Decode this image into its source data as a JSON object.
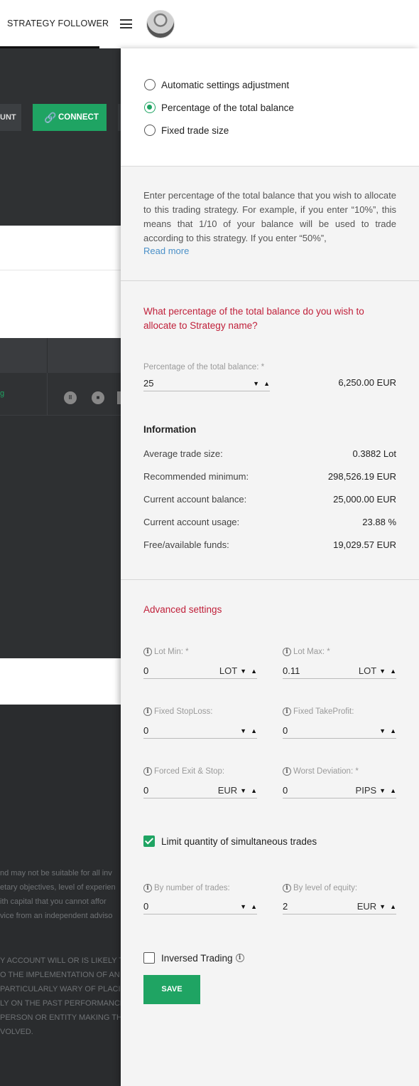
{
  "topbar": {
    "brand": "STRATEGY FOLLOWER"
  },
  "background": {
    "account_button": "UNT",
    "connect_button": "CONNECT",
    "row_status": "g",
    "disclaimer_1": [
      "nd may not be suitable for all inv",
      "etary objectives, level of experien",
      "ith capital that you cannot affor",
      "vice from an independent adviso"
    ],
    "disclaimer_2": [
      "Y ACCOUNT WILL OR IS LIKELY T",
      "O THE IMPLEMENTATION OF AN",
      "PARTICULARLY WARY OF PLACI",
      "LY ON THE PAST PERFORMANCE",
      "PERSON OR ENTITY MAKING TH",
      "VOLVED."
    ]
  },
  "panel": {
    "close_icon": "×",
    "modes": [
      {
        "label": "Automatic settings adjustment",
        "selected": false
      },
      {
        "label": "Percentage of the total balance",
        "selected": true
      },
      {
        "label": "Fixed trade size",
        "selected": false
      }
    ],
    "description": "Enter percentage of the total balance that you wish to allocate to this trading strategy. For example, if you enter “10%”, this means that 1/10 of your balance will be used to trade according to this strategy. If you enter “50%”,",
    "read_more": "Read more",
    "question": "What percentage of the total balance do you wish to allocate to Strategy name?",
    "percentage": {
      "label": "Percentage of the total balance: *",
      "value": "25",
      "calculated": "6,250.00 EUR"
    },
    "information": {
      "title": "Information",
      "rows": [
        {
          "label": "Average trade size:",
          "value": "0.3882 Lot"
        },
        {
          "label": "Recommended minimum:",
          "value": "298,526.19 EUR"
        },
        {
          "label": "Current account balance:",
          "value": "25,000.00 EUR"
        },
        {
          "label": "Current account usage:",
          "value": "23.88 %"
        },
        {
          "label": "Free/available funds:",
          "value": "19,029.57 EUR"
        }
      ]
    },
    "advanced": {
      "title": "Advanced settings",
      "fields": [
        {
          "label": "Lot Min: *",
          "value": "0",
          "unit": "LOT"
        },
        {
          "label": "Lot Max: *",
          "value": "0.11",
          "unit": "LOT"
        },
        {
          "label": "Fixed StopLoss:",
          "value": "0",
          "unit": ""
        },
        {
          "label": "Fixed TakeProfit:",
          "value": "0",
          "unit": ""
        },
        {
          "label": "Forced Exit & Stop:",
          "value": "0",
          "unit": "EUR"
        },
        {
          "label": "Worst Deviation: *",
          "value": "0",
          "unit": "PIPS"
        }
      ]
    },
    "limit_trades": {
      "label": "Limit quantity of simultaneous trades",
      "checked": true,
      "fields": [
        {
          "label": "By number of trades:",
          "value": "0",
          "unit": ""
        },
        {
          "label": "By level of equity:",
          "value": "2",
          "unit": "EUR"
        }
      ]
    },
    "inversed": {
      "label": "Inversed Trading",
      "checked": false
    },
    "save_label": "SAVE"
  },
  "colors": {
    "accent_green": "#1fa463",
    "heading_red": "#c0203a",
    "link_blue": "#4a90c8"
  }
}
